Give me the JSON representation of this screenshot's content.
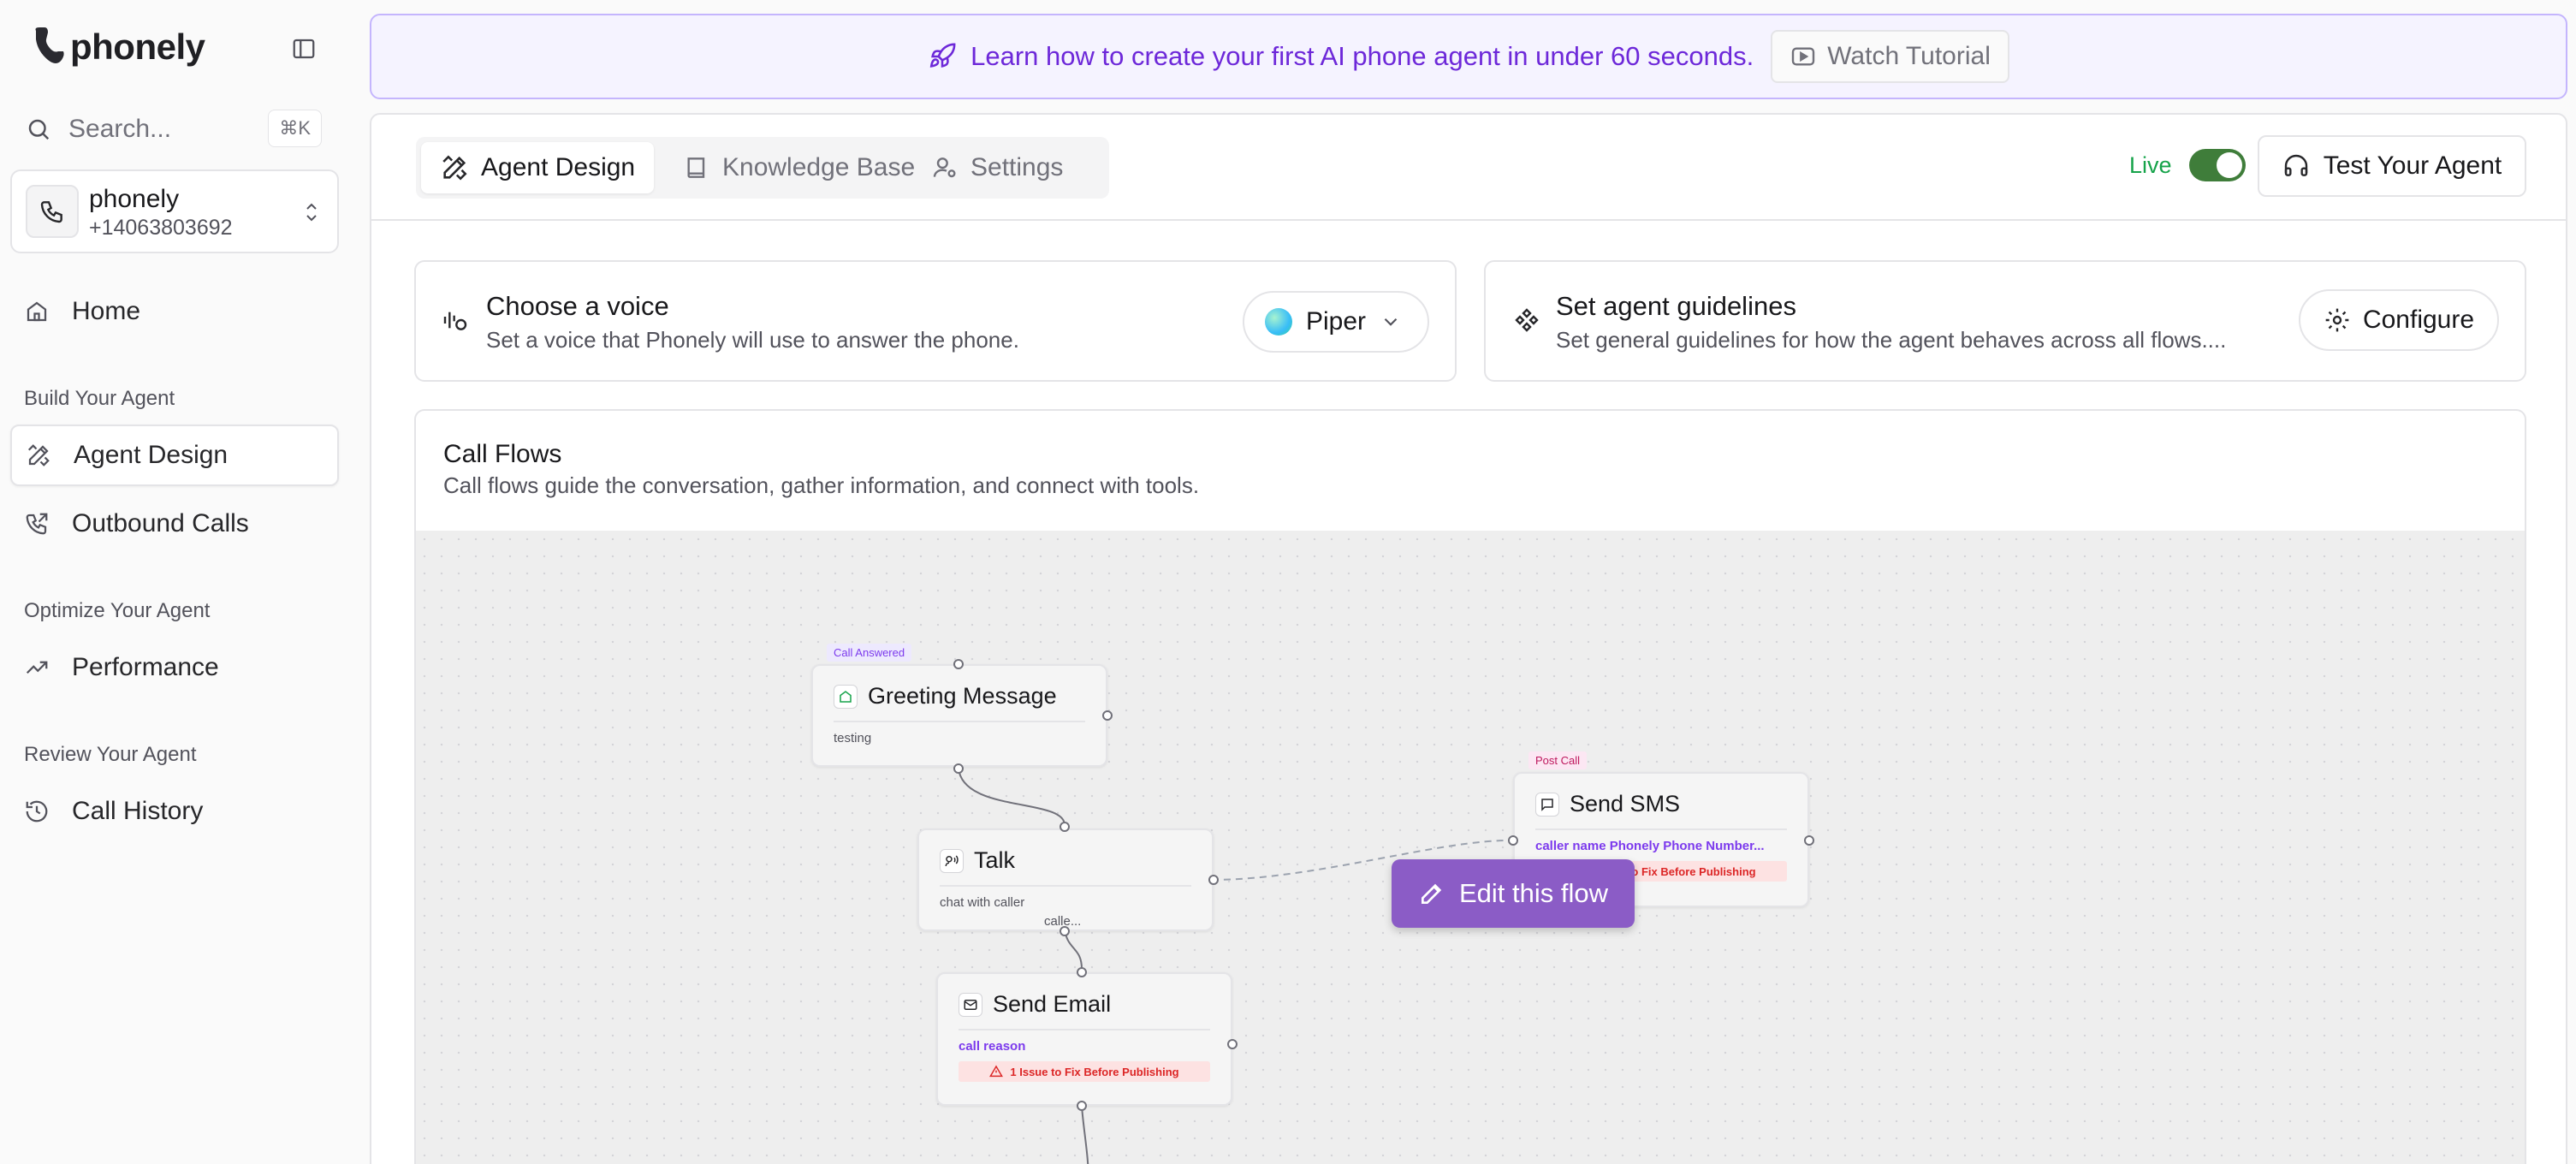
{
  "brand": {
    "name": "phonely"
  },
  "sidebar": {
    "search_label": "Search...",
    "search_shortcut": "⌘K",
    "account": {
      "name": "phonely",
      "phone": "+14063803692"
    },
    "home_label": "Home",
    "sections": {
      "build": "Build Your Agent",
      "optimize": "Optimize Your Agent",
      "review": "Review Your Agent"
    },
    "items": {
      "agent_design": "Agent Design",
      "outbound_calls": "Outbound Calls",
      "performance": "Performance",
      "call_history": "Call History"
    }
  },
  "banner": {
    "text": "Learn how to create your first AI phone agent in under 60 seconds.",
    "button": "Watch Tutorial"
  },
  "tabs": [
    "Agent Design",
    "Knowledge Base",
    "Settings"
  ],
  "header": {
    "live_label": "Live",
    "live_on": true,
    "test_button": "Test Your Agent"
  },
  "voice_card": {
    "title": "Choose a voice",
    "subtitle": "Set a voice that Phonely will use to answer the phone.",
    "selected_voice": "Piper"
  },
  "guidelines_card": {
    "title": "Set agent guidelines",
    "subtitle": "Set general guidelines for how the agent behaves across all flows....",
    "button": "Configure"
  },
  "call_flows": {
    "title": "Call Flows",
    "subtitle": "Call flows guide the conversation, gather information, and connect with tools.",
    "edit_button": "Edit this flow",
    "nodes": {
      "greeting": {
        "tag": "Call Answered",
        "title": "Greeting Message",
        "text": "testing"
      },
      "talk": {
        "title": "Talk",
        "text": "chat with caller",
        "edge_label": "calle..."
      },
      "email": {
        "title": "Send Email",
        "var": "call reason",
        "issue": "1 Issue to Fix Before Publishing"
      },
      "sms": {
        "tag": "Post Call",
        "title": "Send SMS",
        "var": "caller name Phonely Phone Number...",
        "issue": "1 Issue to Fix Before Publishing"
      }
    }
  },
  "colors": {
    "accent": "#6d28d9",
    "button_purple": "#8b5cc6",
    "live_green": "#16a34a"
  }
}
